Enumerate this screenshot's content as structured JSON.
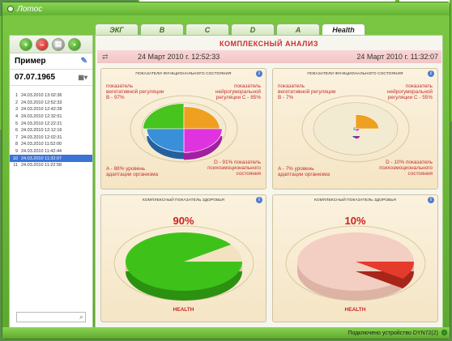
{
  "window": {
    "title": "Лотос"
  },
  "left_panel": {
    "toolbar_icons": [
      "add-icon",
      "delete-icon",
      "print-icon",
      "save-icon"
    ],
    "patient_name": "Пример",
    "birth_date": "07.07.1965",
    "sessions": [
      {
        "num": "1",
        "date": "24.03.2010 13:02:36"
      },
      {
        "num": "2",
        "date": "24.03.2010 12:52:33"
      },
      {
        "num": "3",
        "date": "24.03.2010 12:42:28"
      },
      {
        "num": "4",
        "date": "24.03.2010 12:32:51"
      },
      {
        "num": "5",
        "date": "24.03.2010 12:22:21"
      },
      {
        "num": "6",
        "date": "24.03.2010 12:12:16"
      },
      {
        "num": "7",
        "date": "24.03.2010 12:02:31"
      },
      {
        "num": "8",
        "date": "24.03.2010 11:52:00"
      },
      {
        "num": "9",
        "date": "24.03.2010 11:42:44"
      },
      {
        "num": "10",
        "date": "24.03.2010 11:32:07"
      },
      {
        "num": "11",
        "date": "24.03.2010 11:22:58"
      }
    ],
    "selected_session": 9,
    "search": {
      "placeholder": ""
    }
  },
  "tabs": [
    {
      "label": "ЭКГ",
      "active": false
    },
    {
      "label": "B",
      "active": false
    },
    {
      "label": "C",
      "active": false
    },
    {
      "label": "D",
      "active": false
    },
    {
      "label": "A",
      "active": false
    },
    {
      "label": "Health",
      "active": true
    }
  ],
  "content": {
    "heading": "КОМПЛЕКСНЫЙ АНАЛИЗ",
    "date_left": "24 Март 2010 г. 12:52:33",
    "date_right": "24 Март 2010 г. 11:32:07",
    "functional_panels": [
      {
        "title": "ПОКАЗАТЕЛИ ФУНКЦИОНАЛЬНОГО СОСТОЯНИЯ",
        "labels": {
          "B": "показатель вегетативной регуляции B - 97%",
          "C": "показатель нейрогуморальной регуляции C - 85%",
          "A": "A - 88% уровень адаптации организма",
          "D": "D - 91% показатель психоэмоционального состояния"
        },
        "values": {
          "A": 0.88,
          "B": 0.97,
          "C": 0.85,
          "D": 0.91
        }
      },
      {
        "title": "ПОКАЗАТЕЛИ ФУНКЦИОНАЛЬНОГО СОСТОЯНИЯ",
        "labels": {
          "B": "показатель вегетативной регуляции B - 7%",
          "C": "показатель нейрогуморальной регуляции C - 55%",
          "A": "A - 7% уровень адаптации организма",
          "D": "D - 10% показатель психоэмоционального состояния"
        },
        "values": {
          "A": 0.07,
          "B": 0.07,
          "C": 0.55,
          "D": 0.1
        }
      }
    ],
    "health_panels": [
      {
        "title": "КОМПЛЕКСНЫЙ ПОКАЗАТЕЛЬ ЗДОРОВЬЯ",
        "percent": "90%",
        "value": 0.9,
        "label": "HEALTH"
      },
      {
        "title": "КОМПЛЕКСНЫЙ ПОКАЗАТЕЛЬ ЗДОРОВЬЯ",
        "percent": "10%",
        "value": 0.1,
        "label": "HEALTH"
      }
    ]
  },
  "status_bar": {
    "text": "Подключено устройство DYN72(2)"
  },
  "colors": {
    "window_green": "#6fb83d",
    "quad_A": "#3a8fd9",
    "quad_B": "#47c41e",
    "quad_C": "#f0a020",
    "quad_D": "#e033e0",
    "health_high": "#3ec21a",
    "health_low": "#e43b2b",
    "accent_red": "#c83030"
  }
}
